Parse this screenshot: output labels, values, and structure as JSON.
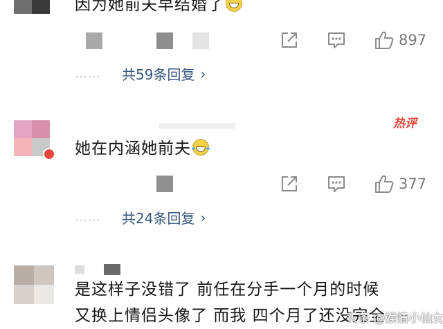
{
  "comments": [
    {
      "text": "因为她前夫早结婚了",
      "emoji": "grinning-face-emoji",
      "likes": "897",
      "replies_label": "共59条回复",
      "replies_dots": "……"
    },
    {
      "text": "她在内涵她前夫",
      "emoji": "laughing-tears-emoji",
      "badge": "热评",
      "likes": "377",
      "replies_label": "共24条回复",
      "replies_dots": "……"
    },
    {
      "text_line1": "是这样子没错了 前任在分手一个月的时候",
      "text_line2": "又换上情侣头像了 而我 四个月了还没完全"
    }
  ],
  "watermark": "头条 @娱情小仙女",
  "icons": {
    "share": "share-icon",
    "comment": "comment-icon",
    "like": "thumbs-up-icon",
    "chevron": "chevron-right-icon"
  },
  "colors": {
    "reply_link": "#34557d",
    "hot_badge": "#e8463a",
    "icon_gray": "#8a8a8a"
  }
}
